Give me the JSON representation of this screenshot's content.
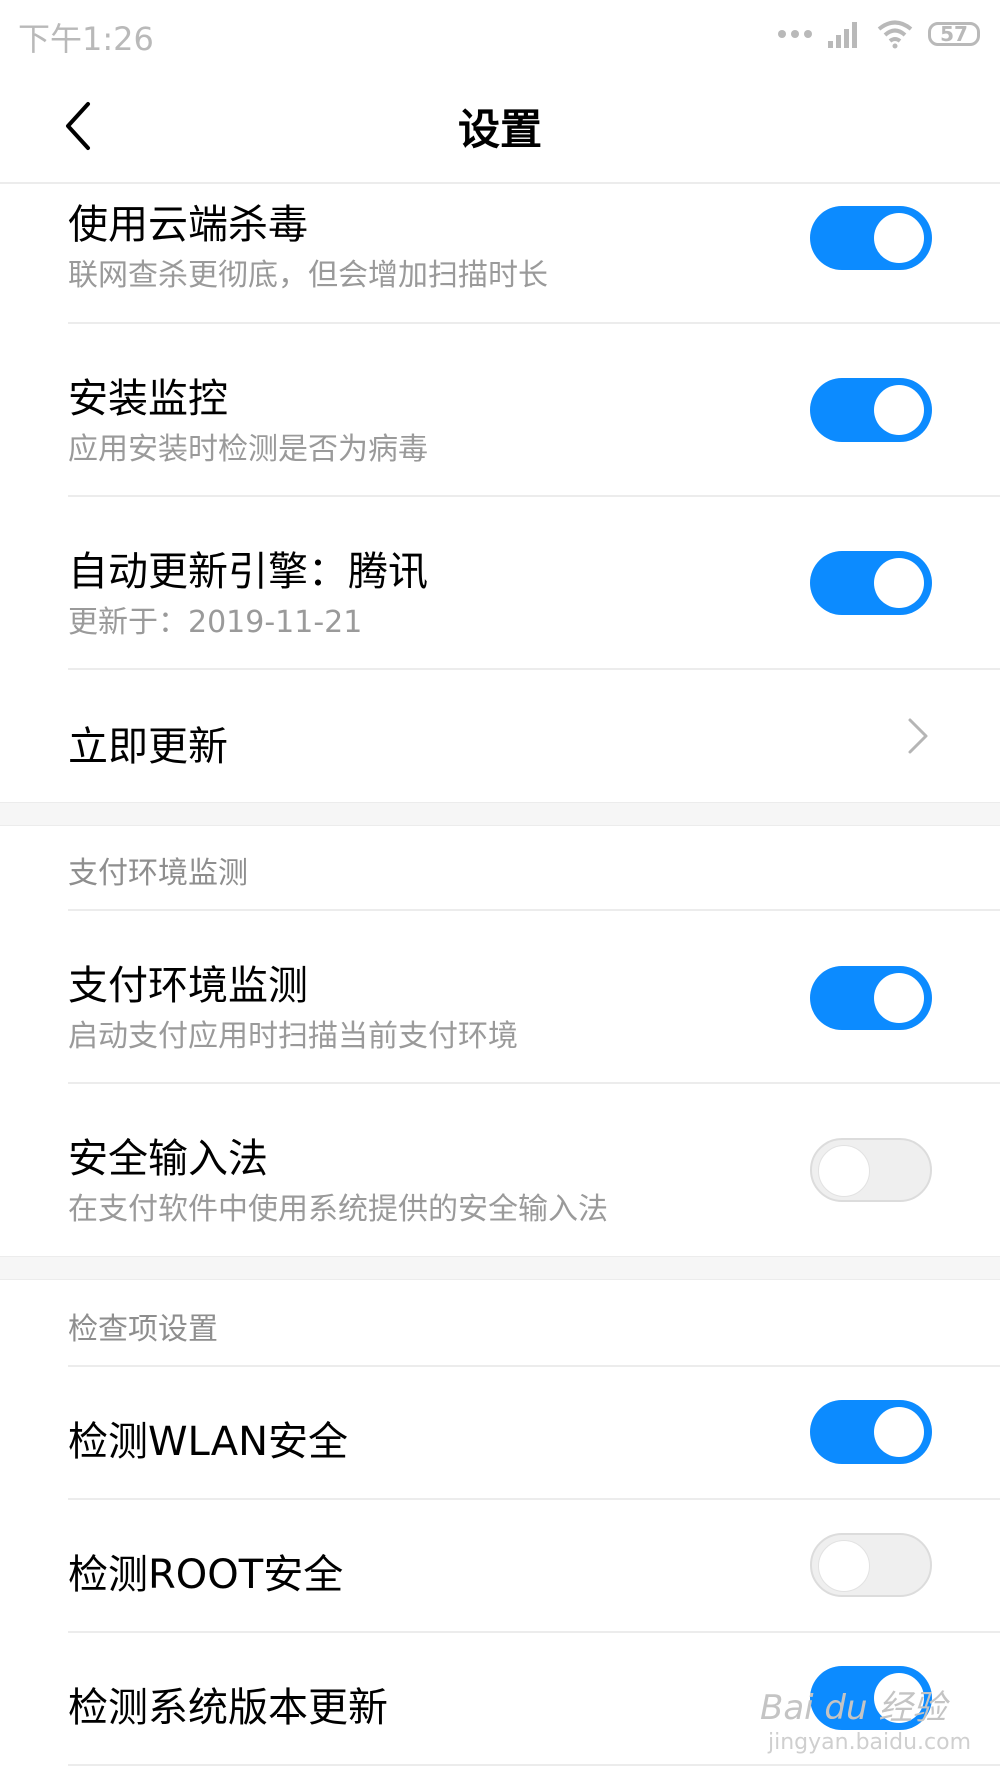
{
  "status_bar": {
    "time": "下午1:26",
    "battery": "57"
  },
  "header": {
    "title": "设置"
  },
  "settings": {
    "cloud_scan": {
      "label": "使用云端杀毒",
      "description": "联网查杀更彻底，但会增加扫描时长",
      "enabled": true
    },
    "install_monitor": {
      "label": "安装监控",
      "description": "应用安装时检测是否为病毒",
      "enabled": true
    },
    "auto_update": {
      "label": "自动更新引擎：腾讯",
      "description": "更新于：2019-11-21",
      "enabled": true
    },
    "update_now": {
      "label": "立即更新"
    }
  },
  "payment_section": {
    "header": "支付环境监测",
    "payment_monitor": {
      "label": "支付环境监测",
      "description": "启动支付应用时扫描当前支付环境",
      "enabled": true
    },
    "secure_keyboard": {
      "label": "安全输入法",
      "description": "在支付软件中使用系统提供的安全输入法",
      "enabled": false
    }
  },
  "check_section": {
    "header": "检查项设置",
    "wlan": {
      "label": "检测WLAN安全",
      "enabled": true
    },
    "root": {
      "label": "检测ROOT安全",
      "enabled": false
    },
    "system_update": {
      "label": "检测系统版本更新",
      "enabled": true
    }
  },
  "watermark": {
    "text": "Bai du 经验",
    "url": "jingyan.baidu.com"
  },
  "colors": {
    "accent": "#0c8bff",
    "toggle_off": "#efefef",
    "subtext": "#9a9a9a"
  }
}
